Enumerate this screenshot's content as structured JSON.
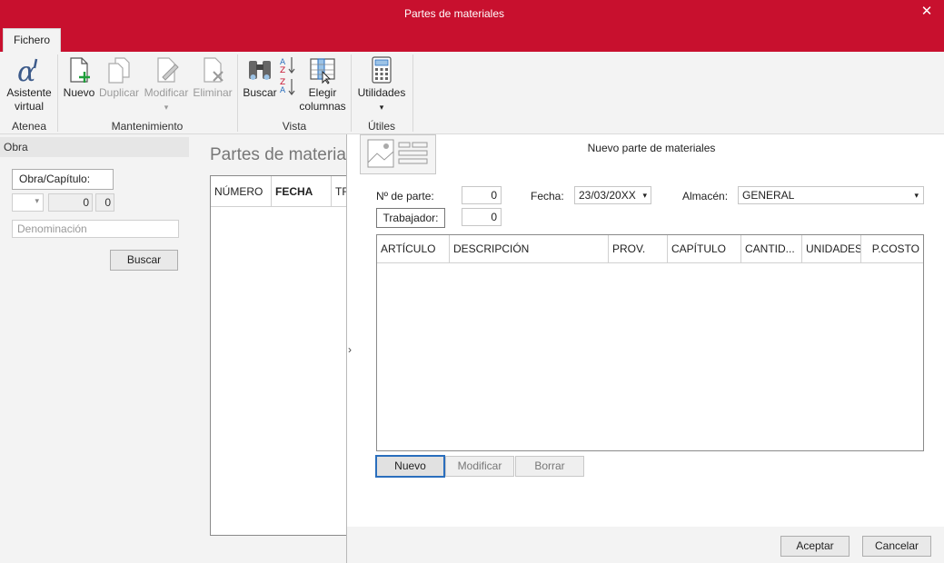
{
  "window": {
    "title": "Partes de materiales",
    "close_glyph": "✕"
  },
  "ribbon": {
    "tab": "Fichero",
    "buttons": {
      "asistente": {
        "line1": "Asistente",
        "line2": "virtual",
        "icon": "alpha-icon"
      },
      "nuevo": "Nuevo",
      "duplicar": "Duplicar",
      "modificar": "Modificar",
      "eliminar": "Eliminar",
      "buscar": "Buscar",
      "elegir": {
        "line1": "Elegir",
        "line2": "columnas"
      },
      "utilidades": "Utilidades"
    },
    "groups": {
      "atenea": "Atenea",
      "mantenimiento": "Mantenimiento",
      "vista": "Vista",
      "utiles": "Útiles"
    },
    "dropdown_glyph": "▾"
  },
  "left_panel": {
    "header": "Obra",
    "obra_capitulo_label": "Obra/Capítulo:",
    "field_a": "0",
    "field_b": "0",
    "denominacion_placeholder": "Denominación",
    "buscar": "Buscar"
  },
  "middle": {
    "title": "Partes de materiales",
    "columns": [
      "NÚMERO",
      "FECHA",
      "TRABAJADOR"
    ]
  },
  "dialog": {
    "title": "Nuevo parte de materiales",
    "n_parte_label": "Nº de parte:",
    "n_parte_value": "0",
    "fecha_label": "Fecha:",
    "fecha_value": "23/03/20XX",
    "almacen_label": "Almacén:",
    "almacen_value": "GENERAL",
    "trabajador_button": "Trabajador:",
    "trabajador_value": "0",
    "grid_columns": [
      "ARTÍCULO",
      "DESCRIPCIÓN",
      "PROV.",
      "CAPÍTULO",
      "CANTID...",
      "UNIDADES",
      "P.COSTO"
    ],
    "line_buttons": {
      "nuevo": "Nuevo",
      "modificar": "Modificar",
      "borrar": "Borrar"
    },
    "aceptar": "Aceptar",
    "cancelar": "Cancelar",
    "collapse_arrow": "›"
  },
  "colors": {
    "accent": "#c8102e",
    "ribbon_bg": "#f3f3f3",
    "focus_border": "#2a6ebd"
  }
}
